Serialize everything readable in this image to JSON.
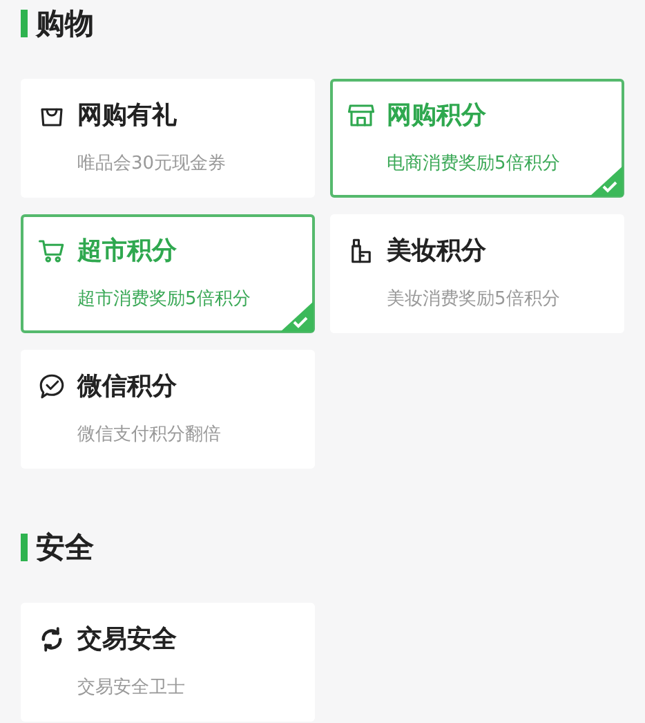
{
  "sections": [
    {
      "title": "购物",
      "cards": [
        {
          "title": "网购有礼",
          "subtitle": "唯品会30元现金券",
          "selected": false
        },
        {
          "title": "网购积分",
          "subtitle": "电商消费奖励5倍积分",
          "selected": true
        },
        {
          "title": "超市积分",
          "subtitle": "超市消费奖励5倍积分",
          "selected": true
        },
        {
          "title": "美妆积分",
          "subtitle": "美妆消费奖励5倍积分",
          "selected": false
        },
        {
          "title": "微信积分",
          "subtitle": "微信支付积分翻倍",
          "selected": false
        }
      ]
    },
    {
      "title": "安全",
      "cards": [
        {
          "title": "交易安全",
          "subtitle": "交易安全卫士",
          "selected": false
        }
      ]
    }
  ]
}
